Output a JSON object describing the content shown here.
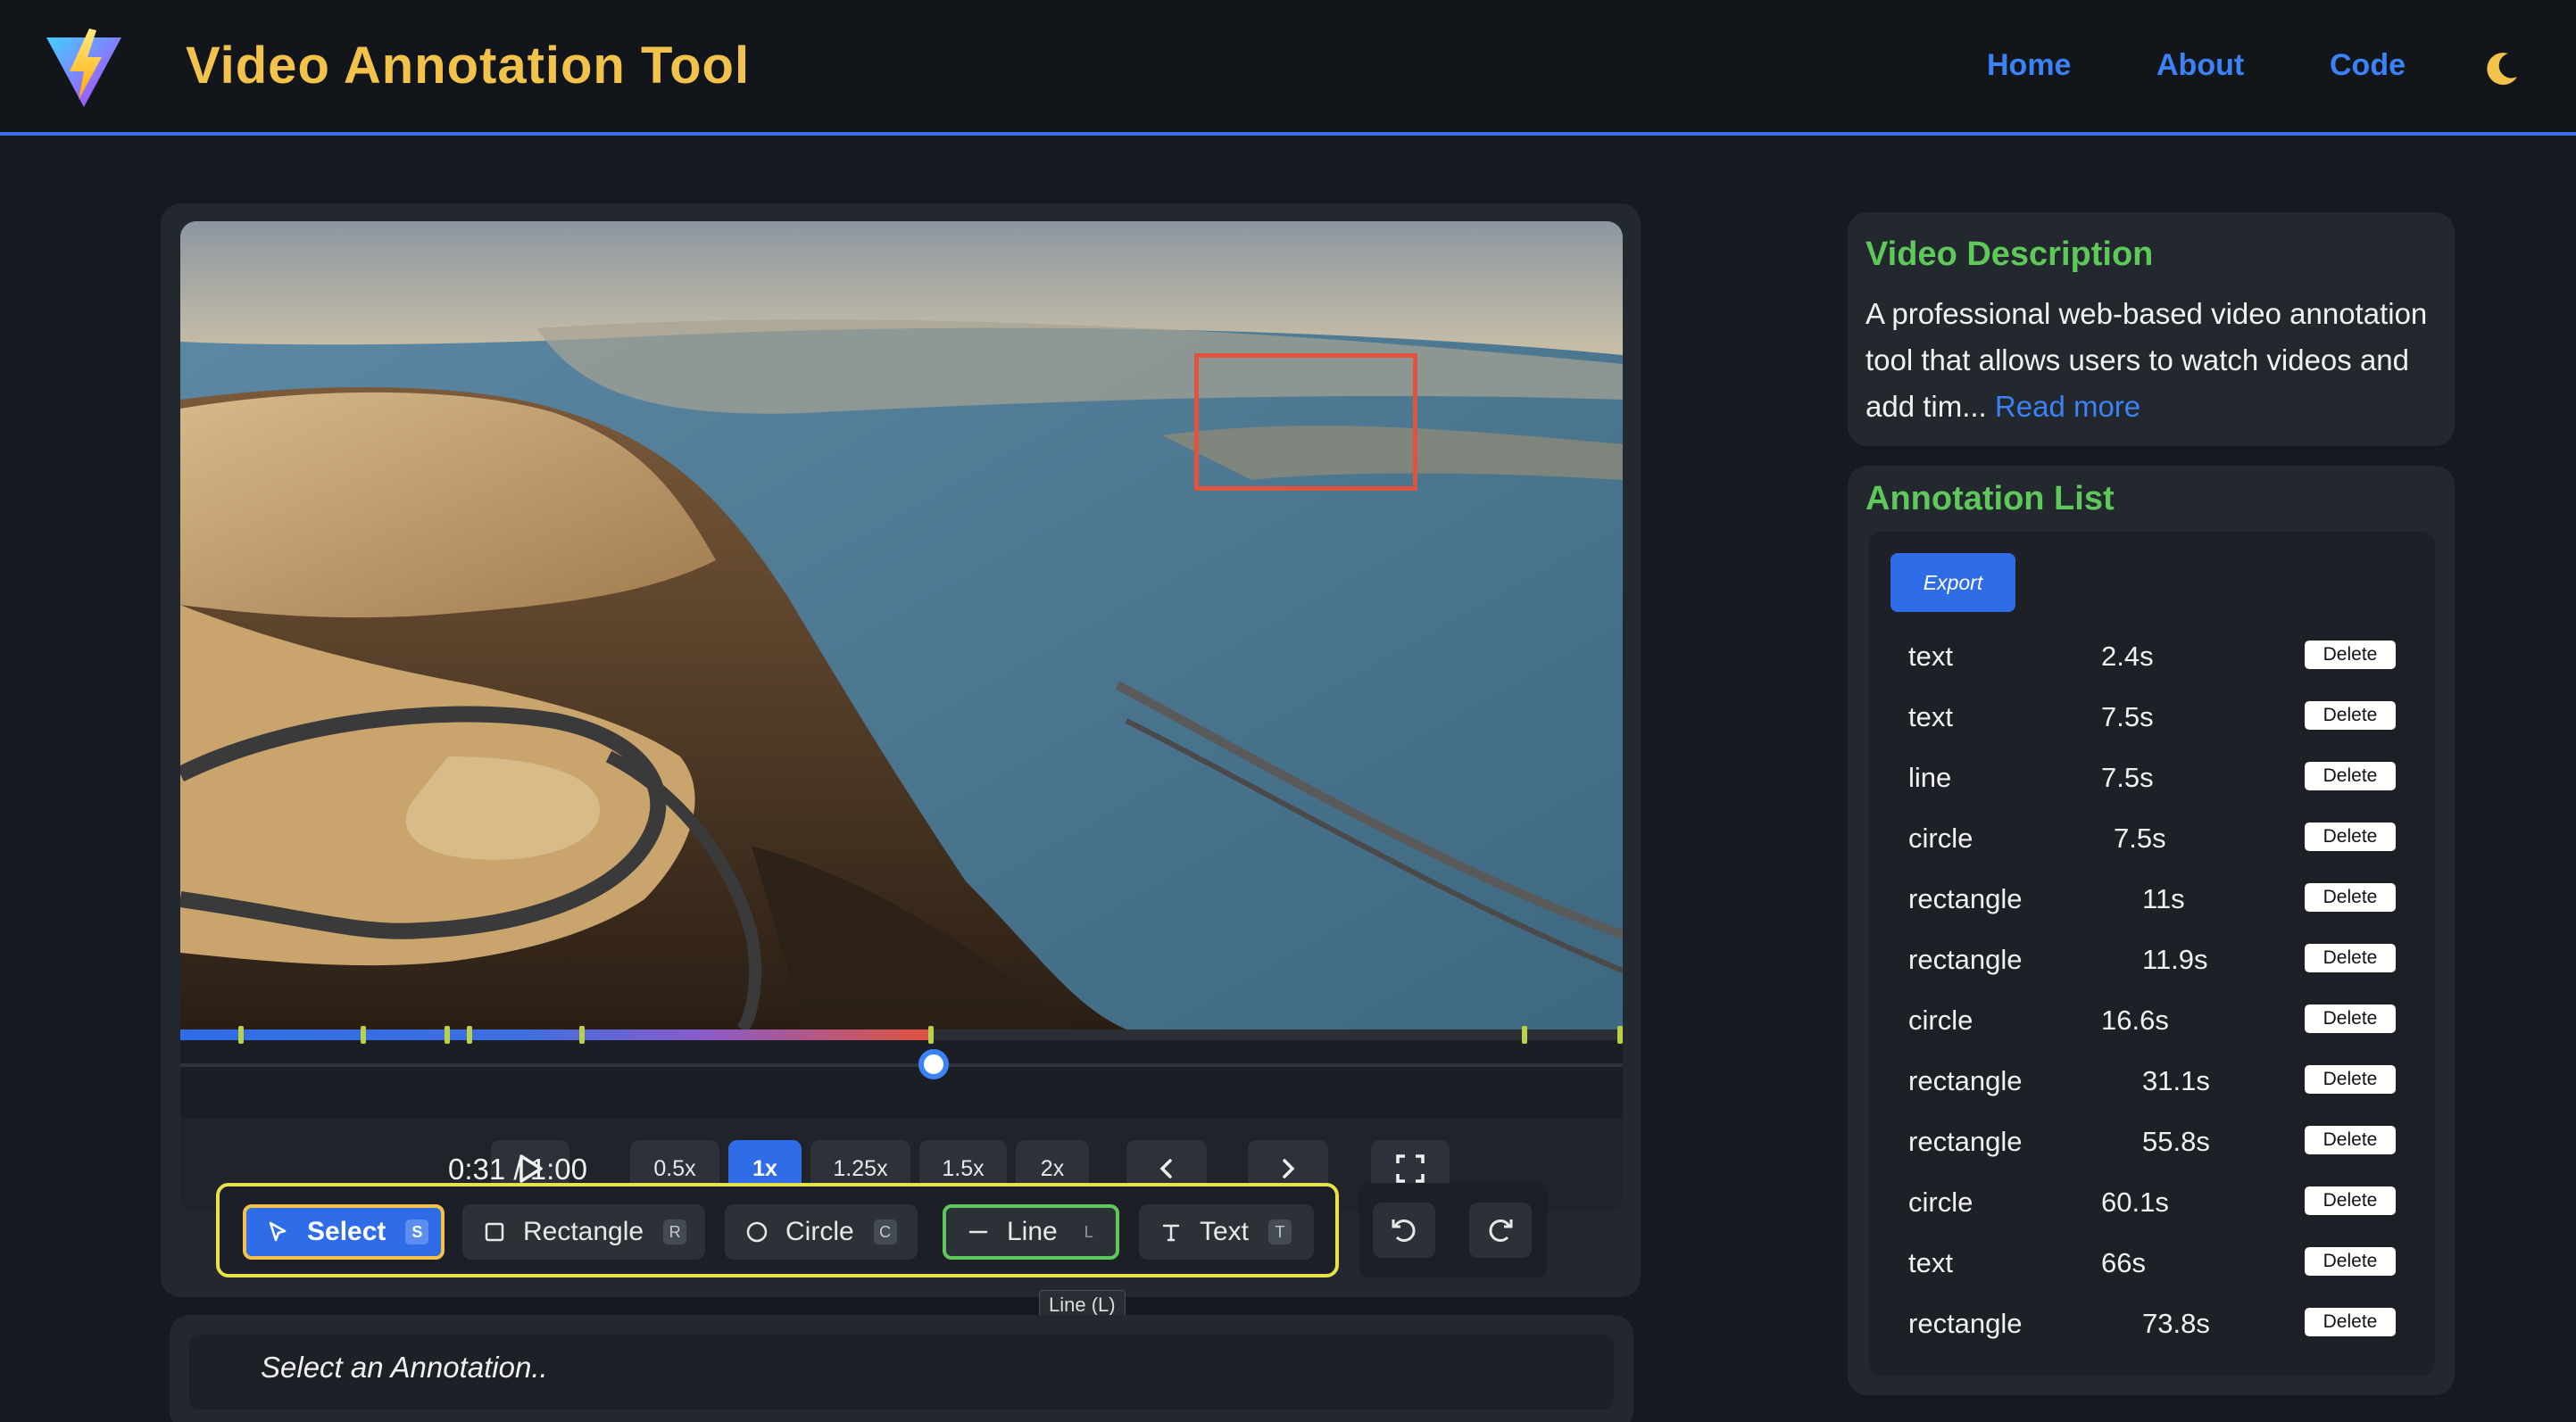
{
  "header": {
    "title": "Video Annotation Tool",
    "nav": [
      "Home",
      "About",
      "Code"
    ],
    "icons": {
      "logo": "vite-logo-icon",
      "theme": "moon-icon"
    }
  },
  "player": {
    "time": "0:31 / 1:00",
    "progress_fraction": 0.52,
    "marker_times_s": [
      2.4,
      7.5,
      11,
      11.9,
      16.6,
      31.1,
      55.8,
      60.1
    ],
    "speeds": [
      "0.5x",
      "1x",
      "1.25x",
      "1.5x",
      "2x"
    ],
    "active_speed": "1x",
    "icons": {
      "play": "play-icon",
      "prev": "chevron-left-icon",
      "next": "chevron-right-icon",
      "fullscreen": "fullscreen-icon"
    }
  },
  "toolbar": {
    "tools": [
      {
        "label": "Select",
        "key": "S",
        "icon": "cursor-icon"
      },
      {
        "label": "Rectangle",
        "key": "R",
        "icon": "square-icon"
      },
      {
        "label": "Circle",
        "key": "C",
        "icon": "circle-icon"
      },
      {
        "label": "Line",
        "key": "L",
        "icon": "line-icon"
      },
      {
        "label": "Text",
        "key": "T",
        "icon": "text-icon"
      }
    ],
    "tooltip": "Line (L)",
    "history_icons": [
      "undo-icon",
      "redo-icon"
    ]
  },
  "selection": {
    "placeholder": "Select an Annotation.."
  },
  "description": {
    "title": "Video Description",
    "text": "A professional web-based video annotation tool that allows users to watch videos and add tim...",
    "read_more": "Read more"
  },
  "annotation_list": {
    "title": "Annotation List",
    "export_label": "Export",
    "delete_label": "Delete",
    "items": [
      {
        "type": "text",
        "time": "2.4s"
      },
      {
        "type": "text",
        "time": "7.5s"
      },
      {
        "type": "line",
        "time": "7.5s"
      },
      {
        "type": "circle",
        "time": "7.5s"
      },
      {
        "type": "rectangle",
        "time": "11s"
      },
      {
        "type": "rectangle",
        "time": "11.9s"
      },
      {
        "type": "circle",
        "time": "16.6s"
      },
      {
        "type": "rectangle",
        "time": "31.1s"
      },
      {
        "type": "rectangle",
        "time": "55.8s"
      },
      {
        "type": "circle",
        "time": "60.1s"
      },
      {
        "type": "text",
        "time": "66s"
      },
      {
        "type": "rectangle",
        "time": "73.8s"
      }
    ]
  },
  "colors": {
    "accent": "#2f6de8",
    "title_gold": "#f3c24a",
    "heading_green": "#5ec95a",
    "annotation_red": "#e0543f",
    "toolbar_border": "#e8e24a"
  }
}
